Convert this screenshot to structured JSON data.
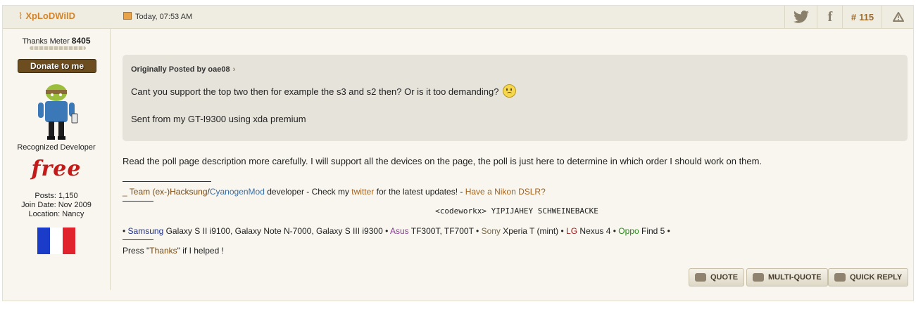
{
  "header": {
    "username": "XpLoDWilD",
    "date": "Today, 07:53 AM",
    "post_number": "115",
    "icons": [
      "twitter-icon",
      "facebook-icon",
      "report-icon"
    ]
  },
  "sidebar": {
    "thanks_label": "Thanks Meter",
    "thanks_count": "8405",
    "donate_label": "Donate to me",
    "rank": "Recognized Developer",
    "carrier_logo": "free",
    "posts": "Posts: 1,150",
    "join_date": "Join Date: Nov 2009",
    "location": "Location: Nancy",
    "flag_colors": [
      "#1a3cc8",
      "#ffffff",
      "#e0232c"
    ]
  },
  "quote": {
    "header": "Originally Posted by oae08",
    "line1": "Cant you support the top two then for example the s3 and s2 then? Or is it too demanding?",
    "line2": "Sent from my GT-I9300 using xda premium"
  },
  "reply": "Read the poll page description more carefully. I will support all the devices on the page, the poll is just here to determine in which order I should work on them.",
  "signature": {
    "line1": {
      "a": "_ Team (ex-)Hacksung",
      "b": "/",
      "c": "CyanogenMod",
      "d": " developer - Check my ",
      "e": "twitter",
      "f": " for the latest updates! - ",
      "g": "Have a Nikon DSLR?"
    },
    "quote_line": "<codeworkx> YIPIJAHEY SCHWEINEBACKE",
    "devices": {
      "s1": "Samsung",
      "s1_models": " Galaxy S II i9100, Galaxy Note N-7000, Galaxy S III i9300 • ",
      "s2": "Asus",
      "s2_models": " TF300T, TF700T • ",
      "s3": "Sony",
      "s3_models": " Xperia T (mint) • ",
      "s4": "LG",
      "s4_models": " Nexus 4 • ",
      "s5": "Oppo",
      "s5_models": " Find 5 •"
    },
    "thanks_line": {
      "a": "Press \"",
      "b": "Thanks",
      "c": "\" if I helped !"
    }
  },
  "buttons": {
    "quote": "QUOTE",
    "multi_quote": "MULTI-QUOTE",
    "quick_reply": "QUICK REPLY"
  }
}
